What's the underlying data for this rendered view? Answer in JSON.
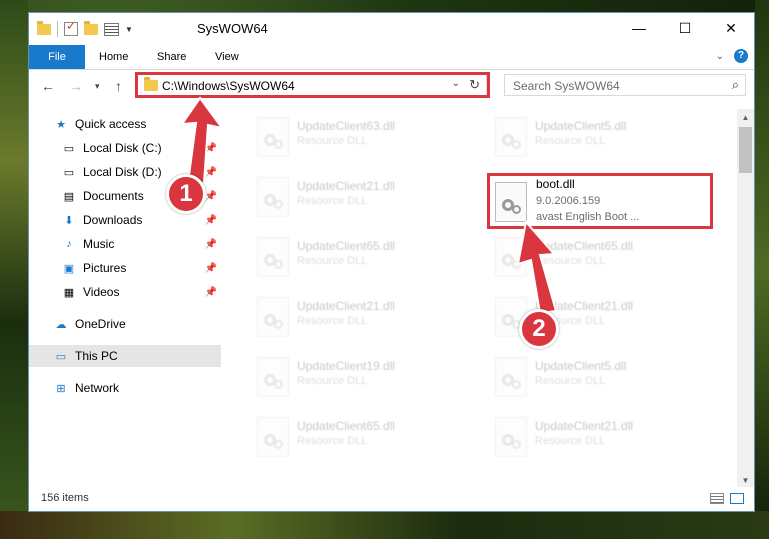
{
  "window": {
    "title": "SysWOW64",
    "minimize": "—",
    "maximize": "☐",
    "close": "✕"
  },
  "ribbon": {
    "file": "File",
    "home": "Home",
    "share": "Share",
    "view": "View"
  },
  "nav": {
    "address": "C:\\Windows\\SysWOW64",
    "search_placeholder": "Search SysWOW64"
  },
  "sidebar": {
    "items": [
      {
        "label": "Quick access",
        "icon": "star-icon"
      },
      {
        "label": "Local Disk (C:)",
        "icon": "drive-icon",
        "pinned": true
      },
      {
        "label": "Local Disk (D:)",
        "icon": "drive-icon",
        "pinned": true
      },
      {
        "label": "Documents",
        "icon": "documents-icon",
        "pinned": true
      },
      {
        "label": "Downloads",
        "icon": "download-icon",
        "pinned": true
      },
      {
        "label": "Music",
        "icon": "music-icon",
        "pinned": true
      },
      {
        "label": "Pictures",
        "icon": "pictures-icon",
        "pinned": true
      },
      {
        "label": "Videos",
        "icon": "videos-icon",
        "pinned": true
      },
      {
        "label": "OneDrive",
        "icon": "cloud-icon"
      },
      {
        "label": "This PC",
        "icon": "computer-icon",
        "selected": true
      },
      {
        "label": "Network",
        "icon": "network-icon"
      }
    ]
  },
  "files": {
    "left": [
      {
        "name": "UpdateClient63.dll",
        "type": "Resource DLL"
      },
      {
        "name": "UpdateClient21.dll",
        "type": "Resource DLL"
      },
      {
        "name": "UpdateClient65.dll",
        "type": "Resource DLL"
      },
      {
        "name": "UpdateClient21.dll",
        "type": "Resource DLL"
      },
      {
        "name": "UpdateClient19.dll",
        "type": "Resource DLL"
      },
      {
        "name": "UpdateClient65.dll",
        "type": "Resource DLL"
      }
    ],
    "right": [
      {
        "name": "UpdateClient5.dll",
        "type": "Resource DLL"
      },
      {
        "name": "UpdateClient65.dll",
        "type": "Resource DLL"
      },
      {
        "name": "UpdateClient21.dll",
        "type": "Resource DLL"
      },
      {
        "name": "UpdateClient5.dll",
        "type": "Resource DLL"
      },
      {
        "name": "UpdateClient21.dll",
        "type": "Resource DLL"
      }
    ],
    "highlighted": {
      "name": "boot.dll",
      "version": "9.0.2006.159",
      "description": "avast English Boot ..."
    }
  },
  "status": {
    "item_count": "156 items"
  },
  "annotations": {
    "step1": "1",
    "step2": "2",
    "color": "#d93640"
  }
}
